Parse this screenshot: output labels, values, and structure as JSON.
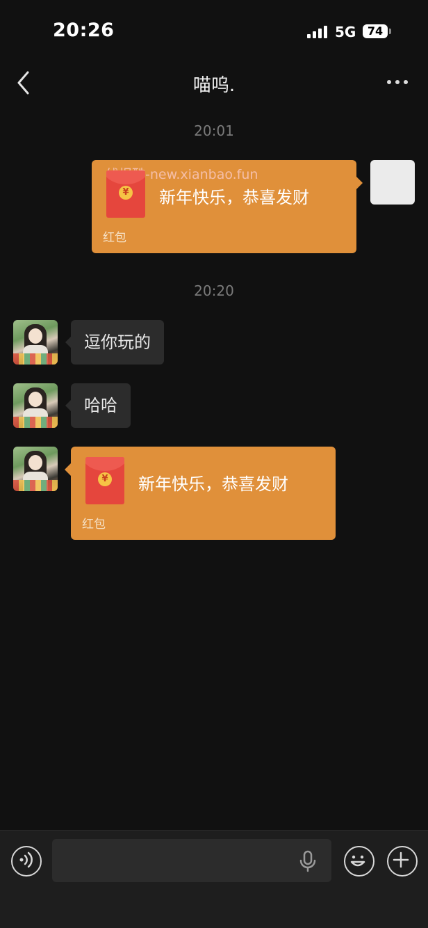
{
  "status": {
    "time": "20:26",
    "network": "5G",
    "battery": "74"
  },
  "nav": {
    "title": "喵呜."
  },
  "timestamps": [
    "20:01",
    "20:20"
  ],
  "messages": {
    "sent_packet": {
      "watermark": "线报酷-new.xianbao.fun",
      "text": "新年快乐，恭喜发财",
      "type_label": "红包",
      "coin_symbol": "¥"
    },
    "text1": "逗你玩的",
    "text2": "哈哈",
    "received_packet": {
      "text": "新年快乐，恭喜发财",
      "type_label": "红包",
      "coin_symbol": "¥"
    }
  },
  "icons": {
    "back": "chevron-left-icon",
    "more": "more-horizontal-icon",
    "voice": "voice-icon",
    "mic": "microphone-icon",
    "emoji": "emoji-icon",
    "plus": "plus-icon"
  },
  "colors": {
    "background": "#111111",
    "packet": "#e0903a",
    "bubble": "#2c2c2c",
    "envelope": "#e5463d"
  }
}
